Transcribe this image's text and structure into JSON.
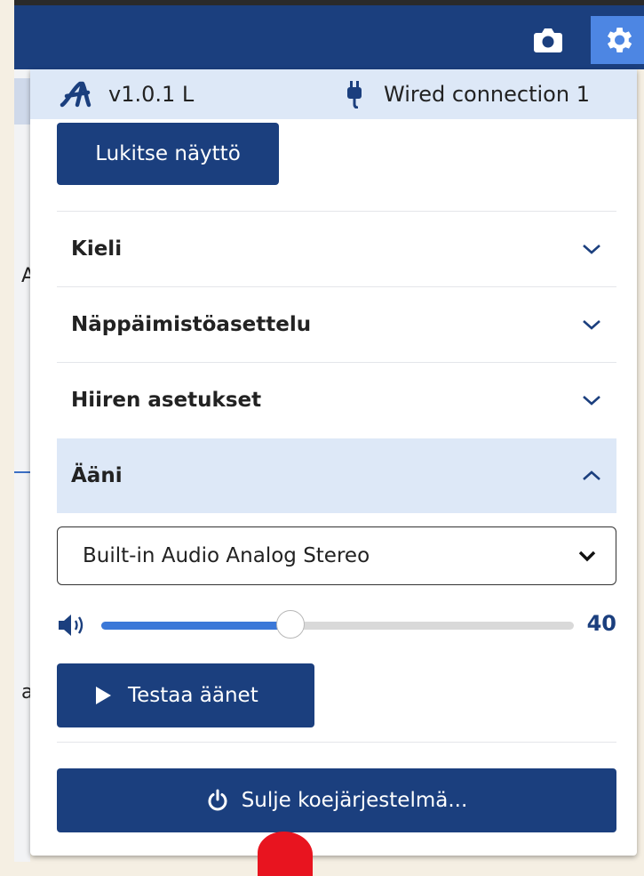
{
  "topbar": {
    "camera_icon": "camera-icon",
    "settings_icon": "gear-icon",
    "accent": "#1b3f7e",
    "active": "#4d86e3"
  },
  "background_fragments": [
    "A",
    "a"
  ],
  "info": {
    "version": "v1.0.1 L",
    "connection": "Wired connection 1"
  },
  "lock_button": "Lukitse näyttö",
  "accordion": [
    {
      "label": "Kieli",
      "expanded": false
    },
    {
      "label": "Näppäimistöasettelu",
      "expanded": false
    },
    {
      "label": "Hiiren asetukset",
      "expanded": false
    },
    {
      "label": "Ääni",
      "expanded": true
    }
  ],
  "audio": {
    "output_device": "Built-in Audio Analog Stereo",
    "volume": 40,
    "volume_max": 100,
    "volume_label": "40",
    "test_button": "Testaa äänet"
  },
  "shutdown_button": "Sulje koejärjestelmä..."
}
